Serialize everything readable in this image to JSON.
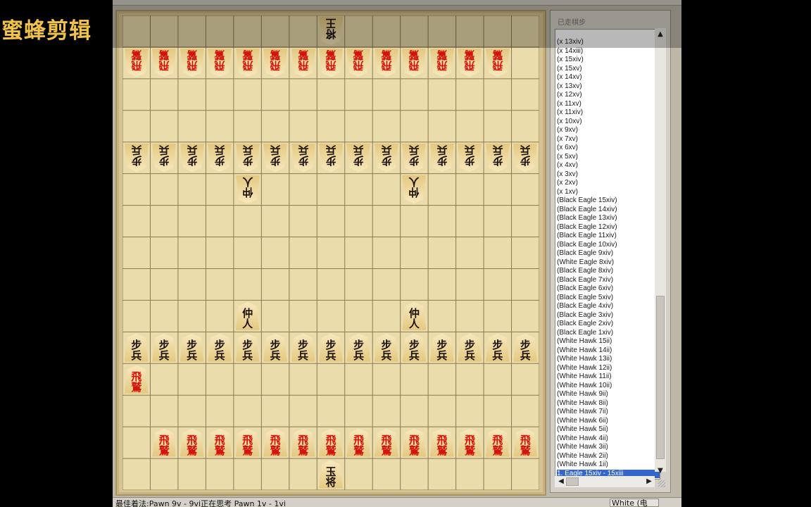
{
  "watermark": "蜜蜂剪辑",
  "move_panel": {
    "caption": "已走棋步",
    "moves": [
      "(x 13xiv)",
      "(x 14xiii)",
      "(x 15xiv)",
      "(x 15xv)",
      "(x 14xv)",
      "(x 13xv)",
      "(x 12xv)",
      "(x 11xv)",
      "(x 11xiv)",
      "(x 10xv)",
      "(x 9xv)",
      "(x 7xv)",
      "(x 6xv)",
      "(x 5xv)",
      "(x 4xv)",
      "(x 3xv)",
      "(x 2xv)",
      "(x 1xv)",
      "(Black Eagle 15xiv)",
      "(Black Eagle 14xiv)",
      "(Black Eagle 13xiv)",
      "(Black Eagle 12xiv)",
      "(Black Eagle 11xiv)",
      "(Black Eagle 10xiv)",
      "(Black Eagle 9xiv)",
      "(White Eagle 8xiv)",
      "(Black Eagle 8xiv)",
      "(Black Eagle 7xiv)",
      "(Black Eagle 6xiv)",
      "(Black Eagle 5xiv)",
      "(Black Eagle 4xiv)",
      "(Black Eagle 3xiv)",
      "(Black Eagle 2xiv)",
      "(Black Eagle 1xiv)",
      "(White Hawk 15ii)",
      "(White Hawk 14ii)",
      "(White Hawk 13ii)",
      "(White Hawk 12ii)",
      "(White Hawk 11ii)",
      "(White Hawk 10ii)",
      "(White Hawk 9ii)",
      "(White Hawk 8ii)",
      "(White Hawk 7ii)",
      "(White Hawk 6ii)",
      "(White Hawk 5ii)",
      "(White Hawk 4ii)",
      "(White Hawk 3ii)",
      "(White Hawk 2ii)",
      "(White Hawk 1ii)",
      "1. Eagle 15xiv - 15xiii"
    ],
    "selected_index": 49
  },
  "status": {
    "text": "最佳着法:Pawn 9v - 9vi正在思考  Pawn 1v - 1vi",
    "side": "White (电脑)"
  },
  "board": {
    "files": 15,
    "ranks": 15,
    "colors": {
      "board": "#ebdcab",
      "line": "#8a7a52",
      "red_text": "#d4140c",
      "black_text": "#1a1008"
    },
    "pieces": [
      {
        "file": 8,
        "rank": 1,
        "k1": "将",
        "k2": "王",
        "color": "black",
        "flip": true
      },
      {
        "file": 1,
        "rank": 2,
        "k1": "飛",
        "k2": "鷲",
        "color": "red",
        "flip": true
      },
      {
        "file": 2,
        "rank": 2,
        "k1": "飛",
        "k2": "鷲",
        "color": "red",
        "flip": true
      },
      {
        "file": 3,
        "rank": 2,
        "k1": "飛",
        "k2": "鷲",
        "color": "red",
        "flip": true
      },
      {
        "file": 4,
        "rank": 2,
        "k1": "飛",
        "k2": "鷲",
        "color": "red",
        "flip": true
      },
      {
        "file": 5,
        "rank": 2,
        "k1": "飛",
        "k2": "鷲",
        "color": "red",
        "flip": true
      },
      {
        "file": 6,
        "rank": 2,
        "k1": "飛",
        "k2": "鷲",
        "color": "red",
        "flip": true
      },
      {
        "file": 7,
        "rank": 2,
        "k1": "飛",
        "k2": "鷲",
        "color": "red",
        "flip": true
      },
      {
        "file": 8,
        "rank": 2,
        "k1": "飛",
        "k2": "鷲",
        "color": "red",
        "flip": true
      },
      {
        "file": 9,
        "rank": 2,
        "k1": "飛",
        "k2": "鷲",
        "color": "red",
        "flip": true
      },
      {
        "file": 10,
        "rank": 2,
        "k1": "飛",
        "k2": "鷲",
        "color": "red",
        "flip": true
      },
      {
        "file": 11,
        "rank": 2,
        "k1": "飛",
        "k2": "鷲",
        "color": "red",
        "flip": true
      },
      {
        "file": 12,
        "rank": 2,
        "k1": "飛",
        "k2": "鷲",
        "color": "red",
        "flip": true
      },
      {
        "file": 13,
        "rank": 2,
        "k1": "飛",
        "k2": "鷲",
        "color": "red",
        "flip": true
      },
      {
        "file": 14,
        "rank": 2,
        "k1": "飛",
        "k2": "鷲",
        "color": "red",
        "flip": true
      },
      {
        "file": 1,
        "rank": 5,
        "k1": "步",
        "k2": "兵",
        "color": "black",
        "flip": true
      },
      {
        "file": 2,
        "rank": 5,
        "k1": "步",
        "k2": "兵",
        "color": "black",
        "flip": true
      },
      {
        "file": 3,
        "rank": 5,
        "k1": "步",
        "k2": "兵",
        "color": "black",
        "flip": true
      },
      {
        "file": 4,
        "rank": 5,
        "k1": "步",
        "k2": "兵",
        "color": "black",
        "flip": true
      },
      {
        "file": 5,
        "rank": 5,
        "k1": "步",
        "k2": "兵",
        "color": "black",
        "flip": true
      },
      {
        "file": 6,
        "rank": 5,
        "k1": "步",
        "k2": "兵",
        "color": "black",
        "flip": true
      },
      {
        "file": 7,
        "rank": 5,
        "k1": "步",
        "k2": "兵",
        "color": "black",
        "flip": true
      },
      {
        "file": 8,
        "rank": 5,
        "k1": "步",
        "k2": "兵",
        "color": "black",
        "flip": true
      },
      {
        "file": 9,
        "rank": 5,
        "k1": "步",
        "k2": "兵",
        "color": "black",
        "flip": true
      },
      {
        "file": 10,
        "rank": 5,
        "k1": "步",
        "k2": "兵",
        "color": "black",
        "flip": true
      },
      {
        "file": 11,
        "rank": 5,
        "k1": "步",
        "k2": "兵",
        "color": "black",
        "flip": true
      },
      {
        "file": 12,
        "rank": 5,
        "k1": "步",
        "k2": "兵",
        "color": "black",
        "flip": true
      },
      {
        "file": 13,
        "rank": 5,
        "k1": "步",
        "k2": "兵",
        "color": "black",
        "flip": true
      },
      {
        "file": 14,
        "rank": 5,
        "k1": "步",
        "k2": "兵",
        "color": "black",
        "flip": true
      },
      {
        "file": 15,
        "rank": 5,
        "k1": "步",
        "k2": "兵",
        "color": "black",
        "flip": true
      },
      {
        "file": 5,
        "rank": 6,
        "k1": "仲",
        "k2": "人",
        "color": "black",
        "flip": true
      },
      {
        "file": 11,
        "rank": 6,
        "k1": "仲",
        "k2": "人",
        "color": "black",
        "flip": true
      },
      {
        "file": 5,
        "rank": 10,
        "k1": "仲",
        "k2": "人",
        "color": "black",
        "flip": false
      },
      {
        "file": 11,
        "rank": 10,
        "k1": "仲",
        "k2": "人",
        "color": "black",
        "flip": false
      },
      {
        "file": 1,
        "rank": 11,
        "k1": "步",
        "k2": "兵",
        "color": "black",
        "flip": false
      },
      {
        "file": 2,
        "rank": 11,
        "k1": "步",
        "k2": "兵",
        "color": "black",
        "flip": false
      },
      {
        "file": 3,
        "rank": 11,
        "k1": "步",
        "k2": "兵",
        "color": "black",
        "flip": false
      },
      {
        "file": 4,
        "rank": 11,
        "k1": "步",
        "k2": "兵",
        "color": "black",
        "flip": false
      },
      {
        "file": 5,
        "rank": 11,
        "k1": "步",
        "k2": "兵",
        "color": "black",
        "flip": false
      },
      {
        "file": 6,
        "rank": 11,
        "k1": "步",
        "k2": "兵",
        "color": "black",
        "flip": false
      },
      {
        "file": 7,
        "rank": 11,
        "k1": "步",
        "k2": "兵",
        "color": "black",
        "flip": false
      },
      {
        "file": 8,
        "rank": 11,
        "k1": "步",
        "k2": "兵",
        "color": "black",
        "flip": false
      },
      {
        "file": 9,
        "rank": 11,
        "k1": "步",
        "k2": "兵",
        "color": "black",
        "flip": false
      },
      {
        "file": 10,
        "rank": 11,
        "k1": "步",
        "k2": "兵",
        "color": "black",
        "flip": false
      },
      {
        "file": 11,
        "rank": 11,
        "k1": "步",
        "k2": "兵",
        "color": "black",
        "flip": false
      },
      {
        "file": 12,
        "rank": 11,
        "k1": "步",
        "k2": "兵",
        "color": "black",
        "flip": false
      },
      {
        "file": 13,
        "rank": 11,
        "k1": "步",
        "k2": "兵",
        "color": "black",
        "flip": false
      },
      {
        "file": 14,
        "rank": 11,
        "k1": "步",
        "k2": "兵",
        "color": "black",
        "flip": false
      },
      {
        "file": 15,
        "rank": 11,
        "k1": "步",
        "k2": "兵",
        "color": "black",
        "flip": false
      },
      {
        "file": 1,
        "rank": 12,
        "k1": "飛",
        "k2": "鷲",
        "color": "red",
        "flip": false
      },
      {
        "file": 2,
        "rank": 14,
        "k1": "飛",
        "k2": "鷲",
        "color": "red",
        "flip": false
      },
      {
        "file": 3,
        "rank": 14,
        "k1": "飛",
        "k2": "鷲",
        "color": "red",
        "flip": false
      },
      {
        "file": 4,
        "rank": 14,
        "k1": "飛",
        "k2": "鷲",
        "color": "red",
        "flip": false
      },
      {
        "file": 5,
        "rank": 14,
        "k1": "飛",
        "k2": "鷲",
        "color": "red",
        "flip": false
      },
      {
        "file": 6,
        "rank": 14,
        "k1": "飛",
        "k2": "鷲",
        "color": "red",
        "flip": false
      },
      {
        "file": 7,
        "rank": 14,
        "k1": "飛",
        "k2": "鷲",
        "color": "red",
        "flip": false
      },
      {
        "file": 8,
        "rank": 14,
        "k1": "飛",
        "k2": "鷲",
        "color": "red",
        "flip": false
      },
      {
        "file": 9,
        "rank": 14,
        "k1": "飛",
        "k2": "鷲",
        "color": "red",
        "flip": false
      },
      {
        "file": 10,
        "rank": 14,
        "k1": "飛",
        "k2": "鷲",
        "color": "red",
        "flip": false
      },
      {
        "file": 11,
        "rank": 14,
        "k1": "飛",
        "k2": "鷲",
        "color": "red",
        "flip": false
      },
      {
        "file": 12,
        "rank": 14,
        "k1": "飛",
        "k2": "鷲",
        "color": "red",
        "flip": false
      },
      {
        "file": 13,
        "rank": 14,
        "k1": "飛",
        "k2": "鷲",
        "color": "red",
        "flip": false
      },
      {
        "file": 14,
        "rank": 14,
        "k1": "飛",
        "k2": "鷲",
        "color": "red",
        "flip": false
      },
      {
        "file": 15,
        "rank": 14,
        "k1": "飛",
        "k2": "鷲",
        "color": "red",
        "flip": false
      },
      {
        "file": 8,
        "rank": 15,
        "k1": "玉",
        "k2": "将",
        "color": "black",
        "flip": false
      }
    ]
  }
}
